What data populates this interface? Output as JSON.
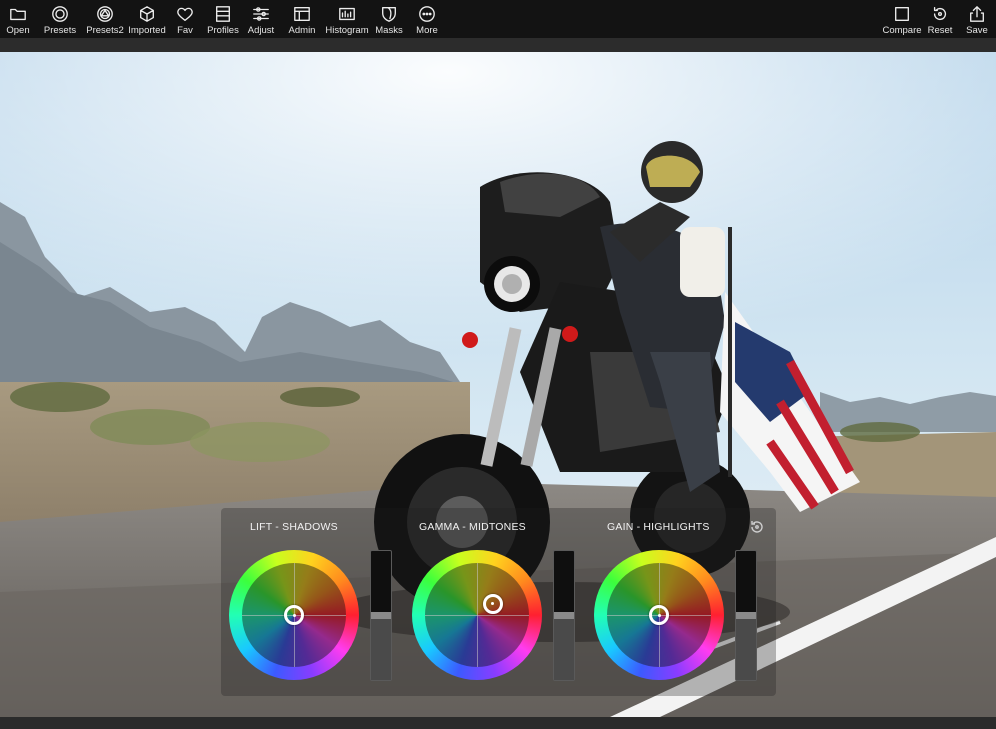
{
  "toolbar": {
    "left_tools": [
      {
        "label": "Open",
        "icon": "folder-icon"
      },
      {
        "label": "Presets",
        "icon": "presets-icon"
      },
      {
        "label": "Presets2",
        "icon": "presets2-icon"
      },
      {
        "label": "Imported",
        "icon": "cube-icon"
      },
      {
        "label": "Fav",
        "icon": "heart-icon"
      },
      {
        "label": "Profiles",
        "icon": "profiles-icon"
      },
      {
        "label": "Adjust",
        "icon": "sliders-icon"
      },
      {
        "label": "Admin",
        "icon": "admin-window-icon"
      },
      {
        "label": "Histogram",
        "icon": "histogram-icon"
      },
      {
        "label": "Masks",
        "icon": "mask-icon"
      },
      {
        "label": "More",
        "icon": "more-icon"
      }
    ],
    "right_tools": [
      {
        "label": "Compare",
        "icon": "compare-icon"
      },
      {
        "label": "Reset",
        "icon": "reset-icon"
      },
      {
        "label": "Save",
        "icon": "share-icon"
      }
    ]
  },
  "color_wheels": {
    "wheels": [
      {
        "title": "LIFT - SHADOWS",
        "handle_offset": [
          0.0,
          0.0
        ],
        "slider_level": 0.5
      },
      {
        "title": "GAMMA - MIDTONES",
        "handle_offset": [
          0.3,
          -0.22
        ],
        "slider_level": 0.5
      },
      {
        "title": "GAIN - HIGHLIGHTS",
        "handle_offset": [
          0.0,
          0.0
        ],
        "slider_level": 0.5
      }
    ],
    "reset_icon": "reset-wheels-icon"
  },
  "colors": {
    "toolbar_bg": "#131313",
    "accent": "#ffffff",
    "sky_top": "#b9d6ec",
    "road": "#6e6a66"
  }
}
